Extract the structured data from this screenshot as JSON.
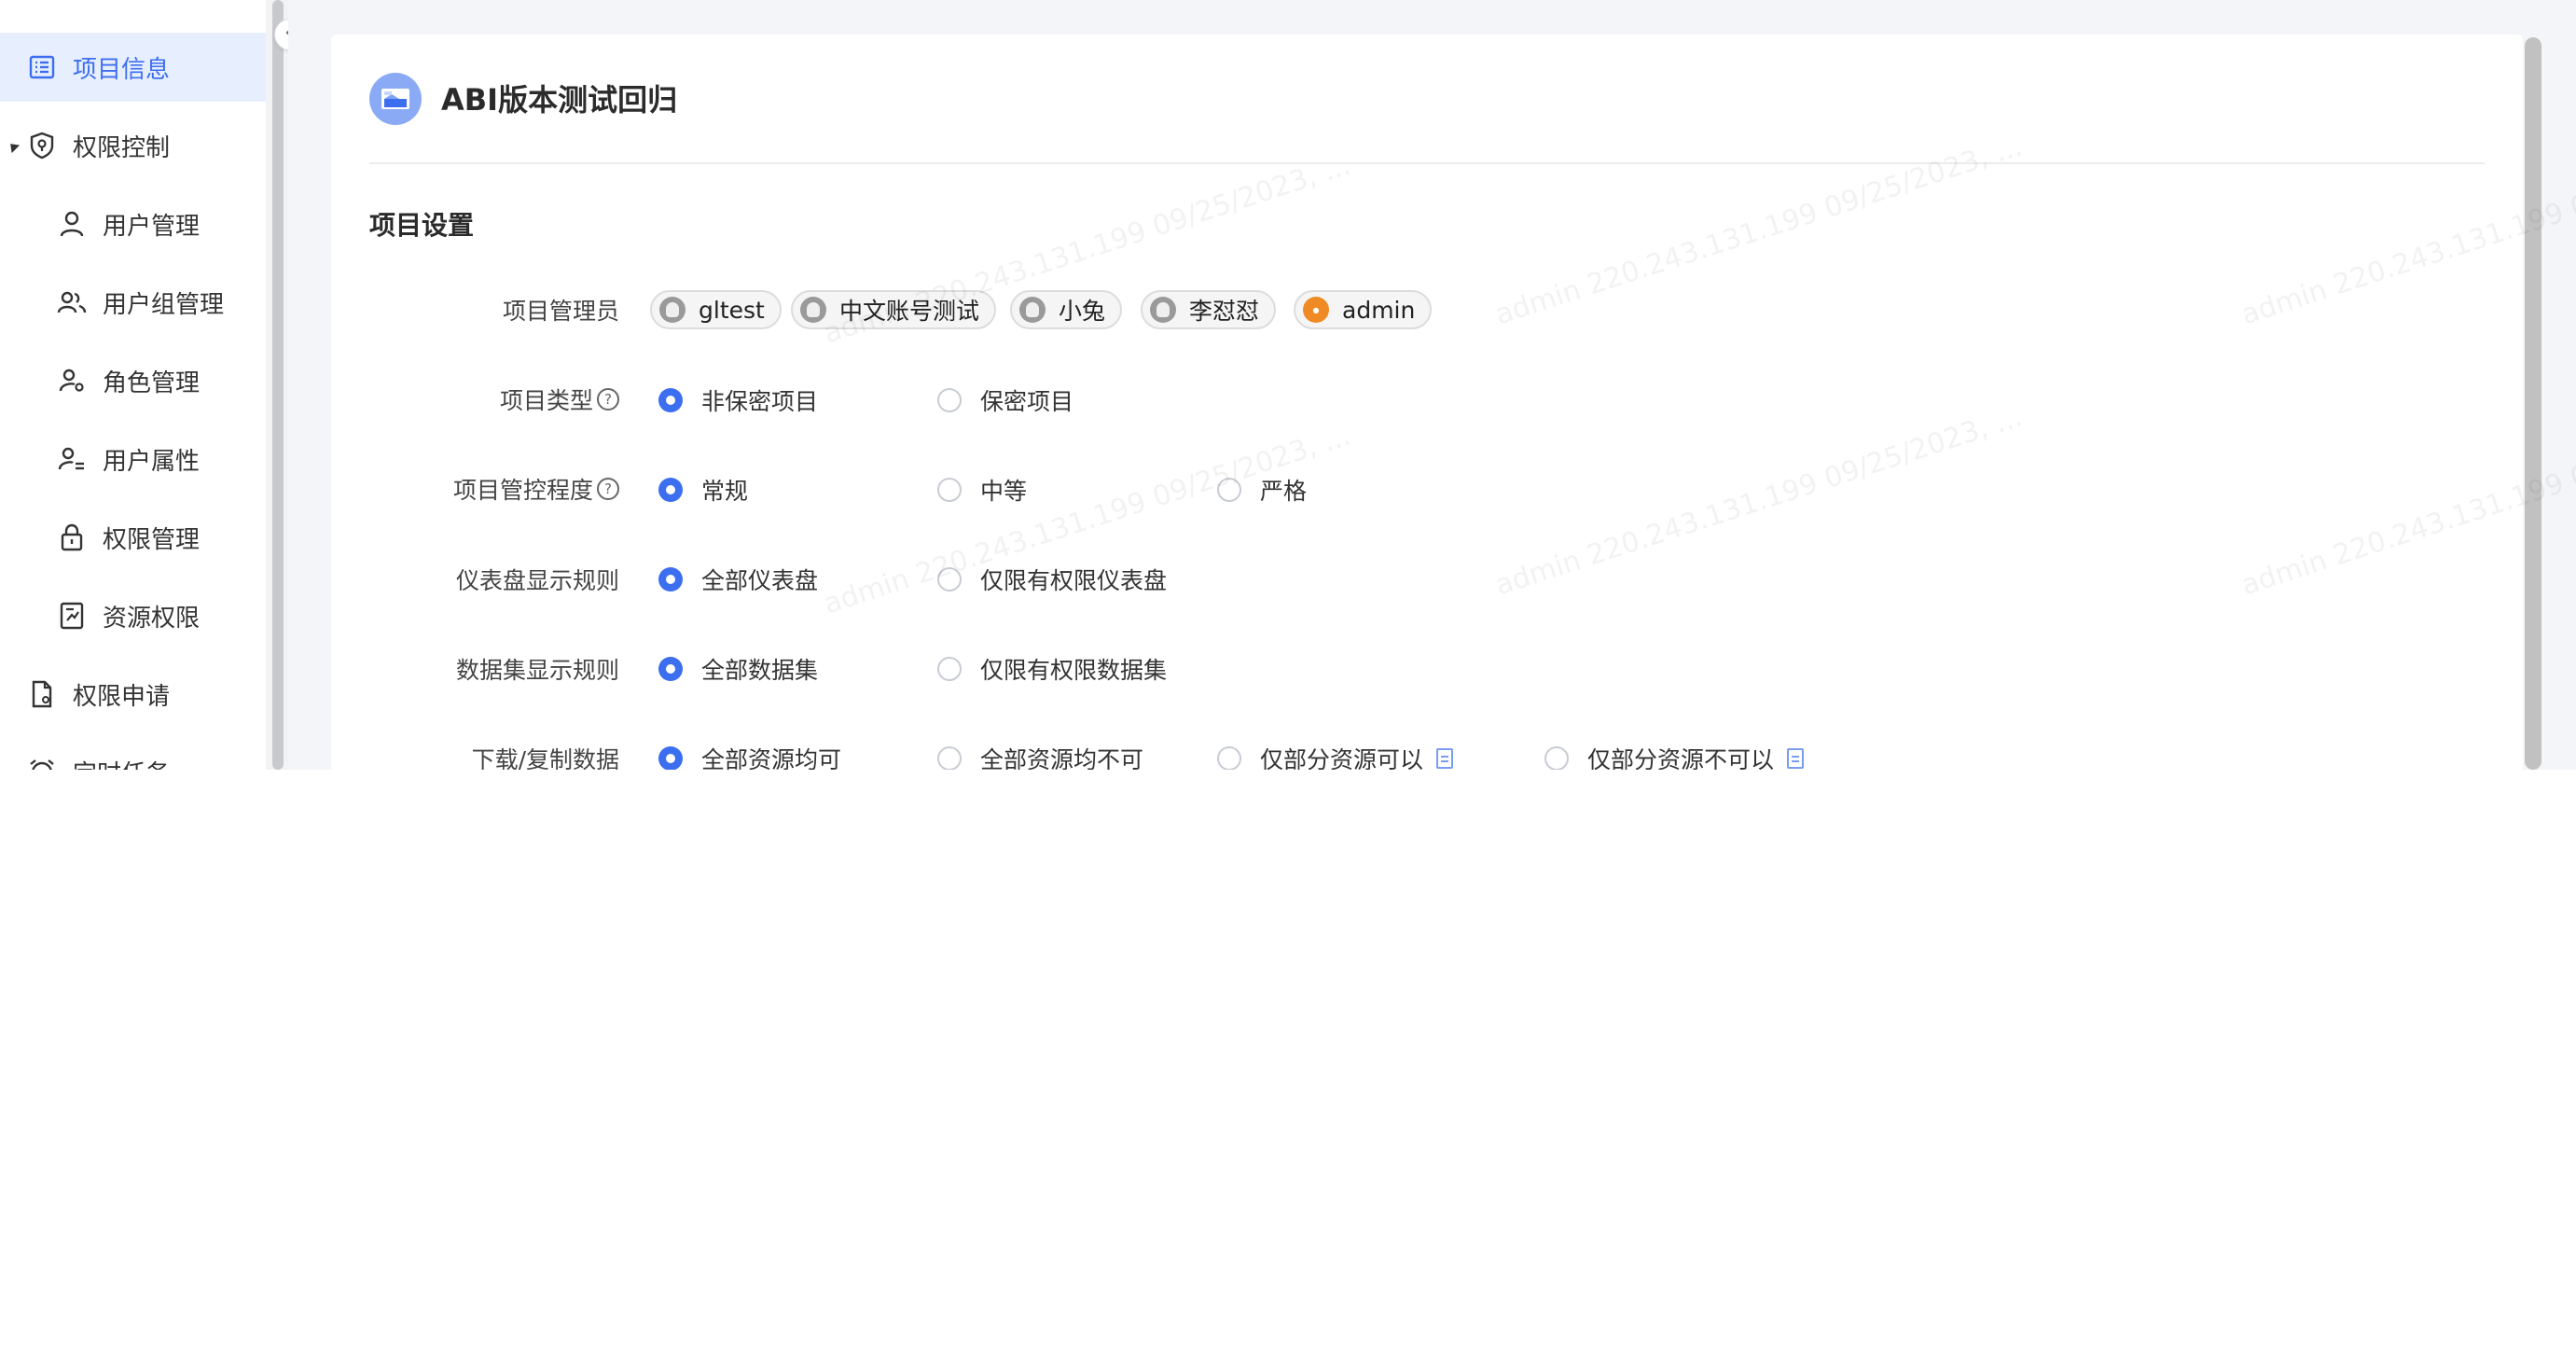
{
  "sidebar": {
    "items": [
      {
        "label": "项目信息",
        "icon": "list-icon",
        "active": true
      },
      {
        "label": "权限控制",
        "icon": "shield-icon",
        "expanded": true
      },
      {
        "label": "用户管理",
        "icon": "user-icon"
      },
      {
        "label": "用户组管理",
        "icon": "user-group-icon"
      },
      {
        "label": "角色管理",
        "icon": "role-icon"
      },
      {
        "label": "用户属性",
        "icon": "user-attribute-icon"
      },
      {
        "label": "权限管理",
        "icon": "lock-icon"
      },
      {
        "label": "资源权限",
        "icon": "resource-permission-icon"
      },
      {
        "label": "权限申请",
        "icon": "document-request-icon"
      },
      {
        "label": "定时任务",
        "icon": "alarm-clock-icon",
        "expanded": true
      }
    ]
  },
  "project": {
    "title": "ABI版本测试回归",
    "section_title": "项目设置"
  },
  "settings": {
    "admins": {
      "label": "项目管理员",
      "users": [
        {
          "name": "gltest",
          "avatar": "default"
        },
        {
          "name": "中文账号测试",
          "avatar": "default"
        },
        {
          "name": "小兔",
          "avatar": "default"
        },
        {
          "name": "李怼怼",
          "avatar": "default"
        },
        {
          "name": "admin",
          "avatar": "orange"
        }
      ]
    },
    "project_type": {
      "label": "项目类型",
      "options": [
        "非保密项目",
        "保密项目"
      ],
      "selected": "非保密项目"
    },
    "control_level": {
      "label": "项目管控程度",
      "options": [
        "常规",
        "中等",
        "严格"
      ],
      "selected": "常规"
    },
    "dashboard_rule": {
      "label": "仪表盘显示规则",
      "options": [
        "全部仪表盘",
        "仅限有权限仪表盘"
      ],
      "selected": "全部仪表盘"
    },
    "dataset_rule": {
      "label": "数据集显示规则",
      "options": [
        "全部数据集",
        "仅限有权限数据集"
      ],
      "selected": "全部数据集"
    },
    "download_copy": {
      "label": "下载/复制数据",
      "options": [
        "全部资源均可",
        "全部资源均不可",
        "仅部分资源可以",
        "仅部分资源不可以"
      ],
      "selected": "全部资源均可"
    }
  },
  "watermark": {
    "text": "admin 220.243.131.199 09/25/2023, ..."
  },
  "colors": {
    "accent": "#3c6ef0",
    "active_bg": "#e7efff",
    "page_bg": "#f4f5f8"
  }
}
